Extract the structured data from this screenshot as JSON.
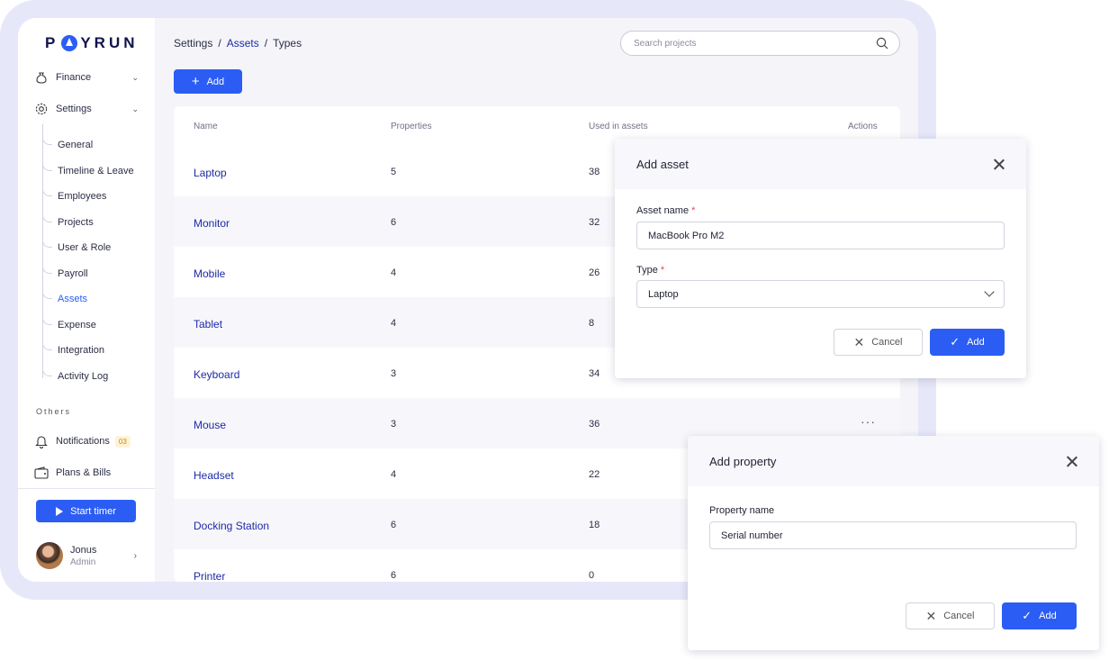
{
  "brand": {
    "logo": "PAYRUN",
    "accent": "#2b5df5"
  },
  "sidebar": {
    "finance": "Finance",
    "settings": "Settings",
    "settings_items": [
      {
        "label": "General"
      },
      {
        "label": "Timeline & Leave"
      },
      {
        "label": "Employees"
      },
      {
        "label": "Projects"
      },
      {
        "label": "User & Role"
      },
      {
        "label": "Payroll"
      },
      {
        "label": "Assets",
        "active": true
      },
      {
        "label": "Expense"
      },
      {
        "label": "Integration"
      },
      {
        "label": "Activity Log"
      }
    ],
    "others_heading": "Others",
    "notifications": "Notifications",
    "notifications_count": "03",
    "plans": "Plans & Bills",
    "start_timer": "Start timer",
    "user": {
      "name": "Jonus",
      "role": "Admin"
    }
  },
  "breadcrumb": {
    "root": "Settings",
    "sep": "/",
    "mid": "Assets",
    "current": "Types"
  },
  "search": {
    "placeholder": "Search projects"
  },
  "toolbar": {
    "add_label": "Add"
  },
  "table": {
    "headers": {
      "name": "Name",
      "properties": "Properties",
      "used": "Used in assets",
      "actions": "Actions"
    },
    "rows": [
      {
        "name": "Laptop",
        "properties": "5",
        "used": "38"
      },
      {
        "name": "Monitor",
        "properties": "6",
        "used": "32"
      },
      {
        "name": "Mobile",
        "properties": "4",
        "used": "26"
      },
      {
        "name": "Tablet",
        "properties": "4",
        "used": "8"
      },
      {
        "name": "Keyboard",
        "properties": "3",
        "used": "34"
      },
      {
        "name": "Mouse",
        "properties": "3",
        "used": "36",
        "actions": "···"
      },
      {
        "name": "Headset",
        "properties": "4",
        "used": "22"
      },
      {
        "name": "Docking Station",
        "properties": "6",
        "used": "18"
      },
      {
        "name": "Printer",
        "properties": "6",
        "used": "0"
      }
    ]
  },
  "add_asset_modal": {
    "title": "Add asset",
    "asset_name_label": "Asset name",
    "required_mark": "*",
    "asset_name_value": "MacBook Pro M2",
    "type_label": "Type",
    "type_value": "Laptop",
    "cancel_label": "Cancel",
    "add_label": "Add"
  },
  "add_property_modal": {
    "title": "Add property",
    "property_name_label": "Property name",
    "property_name_value": "Serial number",
    "cancel_label": "Cancel",
    "add_label": "Add"
  }
}
